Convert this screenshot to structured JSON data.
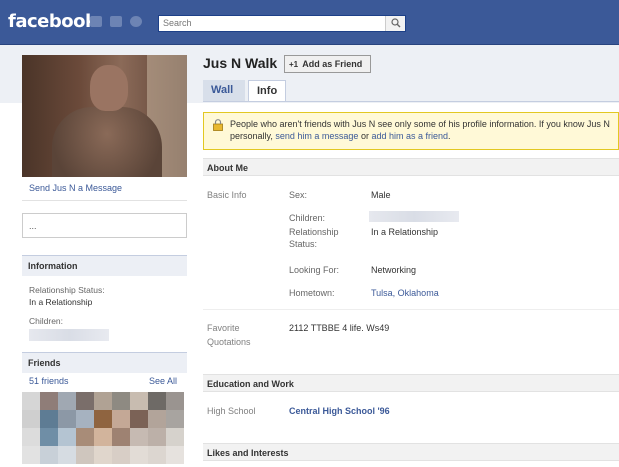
{
  "topbar": {
    "logo": "facebook",
    "search_placeholder": "Search"
  },
  "profile": {
    "name": "Jus N Walk",
    "add_friend_label": "Add as Friend",
    "tabs": [
      {
        "label": "Wall"
      },
      {
        "label": "Info"
      }
    ]
  },
  "left": {
    "send_message": "Send Jus N a Message",
    "status_text": "...",
    "information": {
      "header": "Information",
      "relationship_label": "Relationship Status:",
      "relationship_value": "In a Relationship",
      "children_label": "Children:"
    },
    "friends": {
      "header": "Friends",
      "count": "51 friends",
      "see_all": "See All"
    }
  },
  "notice": {
    "text_pre": "People who aren't friends with Jus N see only some of his profile information. If you know Jus N personally,",
    "link_message": "send him a message",
    "text_or": "or",
    "link_add": "add him as a friend",
    "text_end": "."
  },
  "about": {
    "header": "About Me",
    "basic_info_label": "Basic Info",
    "sex_label": "Sex:",
    "sex_value": "Male",
    "children_label": "Children:",
    "relationship_label_1": "Relationship",
    "relationship_label_2": "Status:",
    "relationship_value": "In a Relationship",
    "looking_for_label": "Looking For:",
    "looking_for_value": "Networking",
    "hometown_label": "Hometown:",
    "hometown_value": "Tulsa, Oklahoma",
    "favorite_label_1": "Favorite",
    "favorite_label_2": "Quotations",
    "favorite_value": "2112 TTBBE 4 life. Ws49"
  },
  "education": {
    "header": "Education and Work",
    "high_school_label": "High School",
    "high_school_value": "Central High School '96"
  },
  "likes": {
    "header": "Likes and Interests"
  },
  "colors": {
    "brand": "#3b5998",
    "notice_bg": "#fff9d7"
  }
}
